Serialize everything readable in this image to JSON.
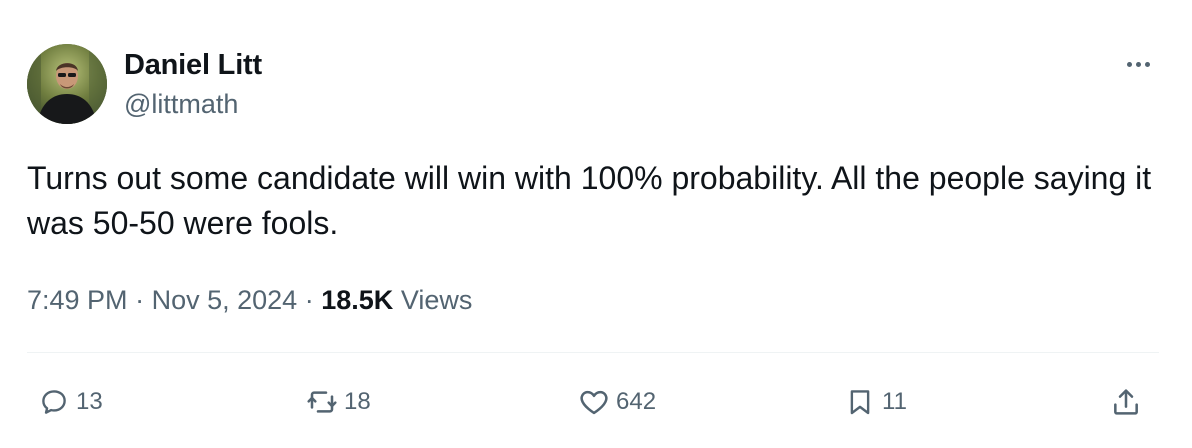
{
  "author": {
    "display_name": "Daniel Litt",
    "handle": "@littmath"
  },
  "tweet": {
    "text": "Turns out some candidate will win with 100% probability. All the people saying it was 50-50 were fools.",
    "time": "7:49 PM",
    "separator": "·",
    "date": "Nov 5, 2024",
    "views_count": "18.5K",
    "views_label": "Views"
  },
  "actions": {
    "replies": "13",
    "reposts": "18",
    "likes": "642",
    "bookmarks": "11"
  },
  "icons": {
    "reply": "reply-icon",
    "repost": "repost-icon",
    "like": "heart-icon",
    "bookmark": "bookmark-icon",
    "share": "share-icon",
    "more": "more-icon"
  },
  "colors": {
    "text_primary": "#0f1419",
    "text_secondary": "#536471",
    "divider": "#eff3f4"
  }
}
